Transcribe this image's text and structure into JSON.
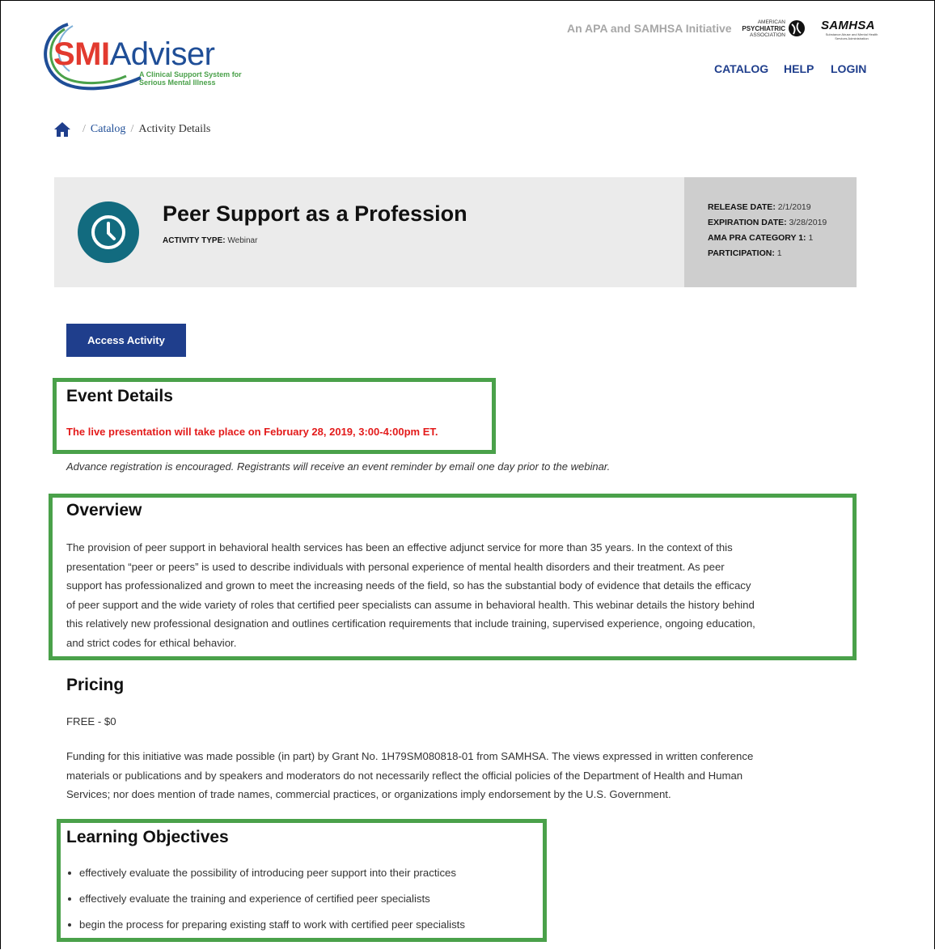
{
  "header": {
    "logo_primary": "SMI",
    "logo_secondary": "Adviser",
    "logo_tagline_1": "A Clinical Support System for",
    "logo_tagline_2": "Serious Mental Illness",
    "initiative_text": "An APA and SAMHSA Initiative",
    "apa_line_1": "AMERICAN",
    "apa_line_2": "PSYCHIATRIC",
    "apa_line_3": "ASSOCIATION",
    "samhsa_text": "SAMHSA",
    "samhsa_sub": "Substance Abuse and Mental Health Services Administration",
    "nav": {
      "catalog": "CATALOG",
      "help": "HELP",
      "login": "LOGIN"
    }
  },
  "breadcrumb": {
    "items": [
      "Catalog",
      "Activity Details"
    ],
    "separator": "/"
  },
  "activity": {
    "title": "Peer Support as a Profession",
    "type_label": "ACTIVITY TYPE:",
    "type_value": "Webinar",
    "release_label": "RELEASE DATE:",
    "release_value": "2/1/2019",
    "expiration_label": "EXPIRATION DATE:",
    "expiration_value": "3/28/2019",
    "ama_label": "AMA PRA CATEGORY 1:",
    "ama_value": "1",
    "participation_label": "PARTICIPATION:",
    "participation_value": "1"
  },
  "access_button": "Access Activity",
  "event_details": {
    "heading": "Event Details",
    "live_note": "The live presentation will take place on February 28, 2019, 3:00-4:00pm ET.",
    "registration_note": "Advance registration is encouraged. Registrants will receive an event reminder by email one day prior to the webinar."
  },
  "overview": {
    "heading": "Overview",
    "lines": [
      "The provision of peer support in behavioral health services has been an effective adjunct service for more than 35 years. In the context of this",
      "presentation “peer or peers” is used to describe individuals with personal experience of mental health disorders and their treatment. As peer",
      "support has professionalized and grown to meet the increasing needs of the field, so has the substantial body of evidence that details the efficacy",
      "of peer support and the wide variety of roles that certified peer specialists can assume in behavioral health. This webinar details the history behind",
      "this relatively new professional designation and outlines certification requirements that include training, supervised experience, ongoing education,",
      "and strict codes for ethical behavior."
    ]
  },
  "pricing": {
    "heading": "Pricing",
    "price": "FREE - $0",
    "funding_lines": [
      "Funding for this initiative was made possible (in part) by Grant No. 1H79SM080818-01 from SAMHSA. The views expressed in written conference",
      "materials or publications and by speakers and moderators do not necessarily reflect the official policies of the Department of Health and Human",
      "Services; nor does mention of trade names, commercial practices, or organizations imply endorsement by the U.S. Government."
    ]
  },
  "learning_objectives": {
    "heading": "Learning Objectives",
    "items": [
      "effectively evaluate the possibility of introducing peer support into their practices",
      "effectively evaluate the training and experience of certified peer specialists",
      "begin the process for preparing existing staff to work with certified peer specialists"
    ]
  },
  "colors": {
    "brand_blue": "#1f3e8c",
    "logo_red": "#e23a2f",
    "highlight_green": "#4aa14a",
    "alert_red": "#e31b1b",
    "icon_teal": "#126b7f"
  }
}
